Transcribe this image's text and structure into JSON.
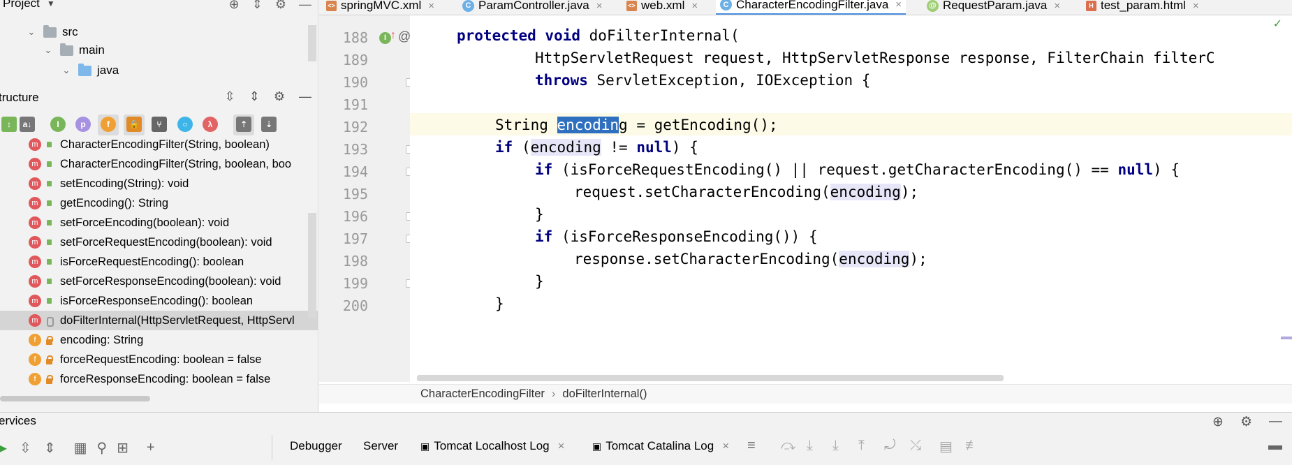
{
  "project_panel": {
    "title": "Project",
    "tree": [
      {
        "label": "src",
        "icon": "folder-icon"
      },
      {
        "label": "main",
        "icon": "folder-icon"
      },
      {
        "label": "java",
        "icon": "source-folder-icon"
      }
    ]
  },
  "structure_panel": {
    "title": "tructure",
    "members": [
      {
        "label": "CharacterEncodingFilter(String, boolean)",
        "kind": "m",
        "vis": "pub"
      },
      {
        "label": "CharacterEncodingFilter(String, boolean, boo",
        "kind": "m",
        "vis": "pub"
      },
      {
        "label": "setEncoding(String): void",
        "kind": "m",
        "vis": "pub"
      },
      {
        "label": "getEncoding(): String",
        "kind": "m",
        "vis": "pub"
      },
      {
        "label": "setForceEncoding(boolean): void",
        "kind": "m",
        "vis": "pub"
      },
      {
        "label": "setForceRequestEncoding(boolean): void",
        "kind": "m",
        "vis": "pub"
      },
      {
        "label": "isForceRequestEncoding(): boolean",
        "kind": "m",
        "vis": "pub"
      },
      {
        "label": "setForceResponseEncoding(boolean): void",
        "kind": "m",
        "vis": "pub"
      },
      {
        "label": "isForceResponseEncoding(): boolean",
        "kind": "m",
        "vis": "pub"
      },
      {
        "label": "doFilterInternal(HttpServletRequest, HttpServl",
        "kind": "m",
        "vis": "prot",
        "selected": true
      },
      {
        "label": "encoding: String",
        "kind": "f",
        "vis": "lock"
      },
      {
        "label": "forceRequestEncoding: boolean = false",
        "kind": "f",
        "vis": "lock"
      },
      {
        "label": "forceResponseEncoding: boolean = false",
        "kind": "f",
        "vis": "lock"
      }
    ]
  },
  "tabs": [
    {
      "label": "springMVC.xml",
      "icon": "xml"
    },
    {
      "label": "ParamController.java",
      "icon": "c"
    },
    {
      "label": "web.xml",
      "icon": "xml"
    },
    {
      "label": "CharacterEncodingFilter.java",
      "icon": "c",
      "active": true
    },
    {
      "label": "RequestParam.java",
      "icon": "at"
    },
    {
      "label": "test_param.html",
      "icon": "html"
    }
  ],
  "editor": {
    "lines": [
      {
        "num": "188",
        "code_kw": "protected void ",
        "code": "doFilterInternal("
      },
      {
        "num": "189",
        "code": "HttpServletRequest request, HttpServletResponse response, FilterChain filterC"
      },
      {
        "num": "190",
        "code_kw": "throws ",
        "code": "ServletException, IOException {"
      },
      {
        "num": "191",
        "code": ""
      },
      {
        "num": "192",
        "pre": "String ",
        "sel": "encodin",
        "post": "g = getEncoding();"
      },
      {
        "num": "193",
        "code_kw": "if ",
        "code_a": "(",
        "occ": "encoding",
        "code_b": " != ",
        "kw2": "null",
        "code_c": ") {"
      },
      {
        "num": "194",
        "code_kw": "if ",
        "code": "(isForceRequestEncoding() || request.getCharacterEncoding() == ",
        "kw2": "null",
        "code_c": ") {"
      },
      {
        "num": "195",
        "code_a": "request.setCharacterEncoding(",
        "occ": "encoding",
        "code_c": ");"
      },
      {
        "num": "196",
        "code": "}"
      },
      {
        "num": "197",
        "code_kw": "if ",
        "code": "(isForceResponseEncoding()) {"
      },
      {
        "num": "198",
        "code_a": "response.setCharacterEncoding(",
        "occ": "encoding",
        "code_c": ");"
      },
      {
        "num": "199",
        "code": "}"
      },
      {
        "num": "200",
        "code": "}"
      }
    ],
    "breadcrumb": {
      "first": "CharacterEncodingFilter",
      "sep": "›",
      "second": "doFilterInternal()"
    }
  },
  "services": {
    "title": "ervices",
    "tabs": [
      {
        "label": "Debugger"
      },
      {
        "label": "Server"
      },
      {
        "label": "Tomcat Localhost Log"
      },
      {
        "label": "Tomcat Catalina Log"
      }
    ]
  }
}
